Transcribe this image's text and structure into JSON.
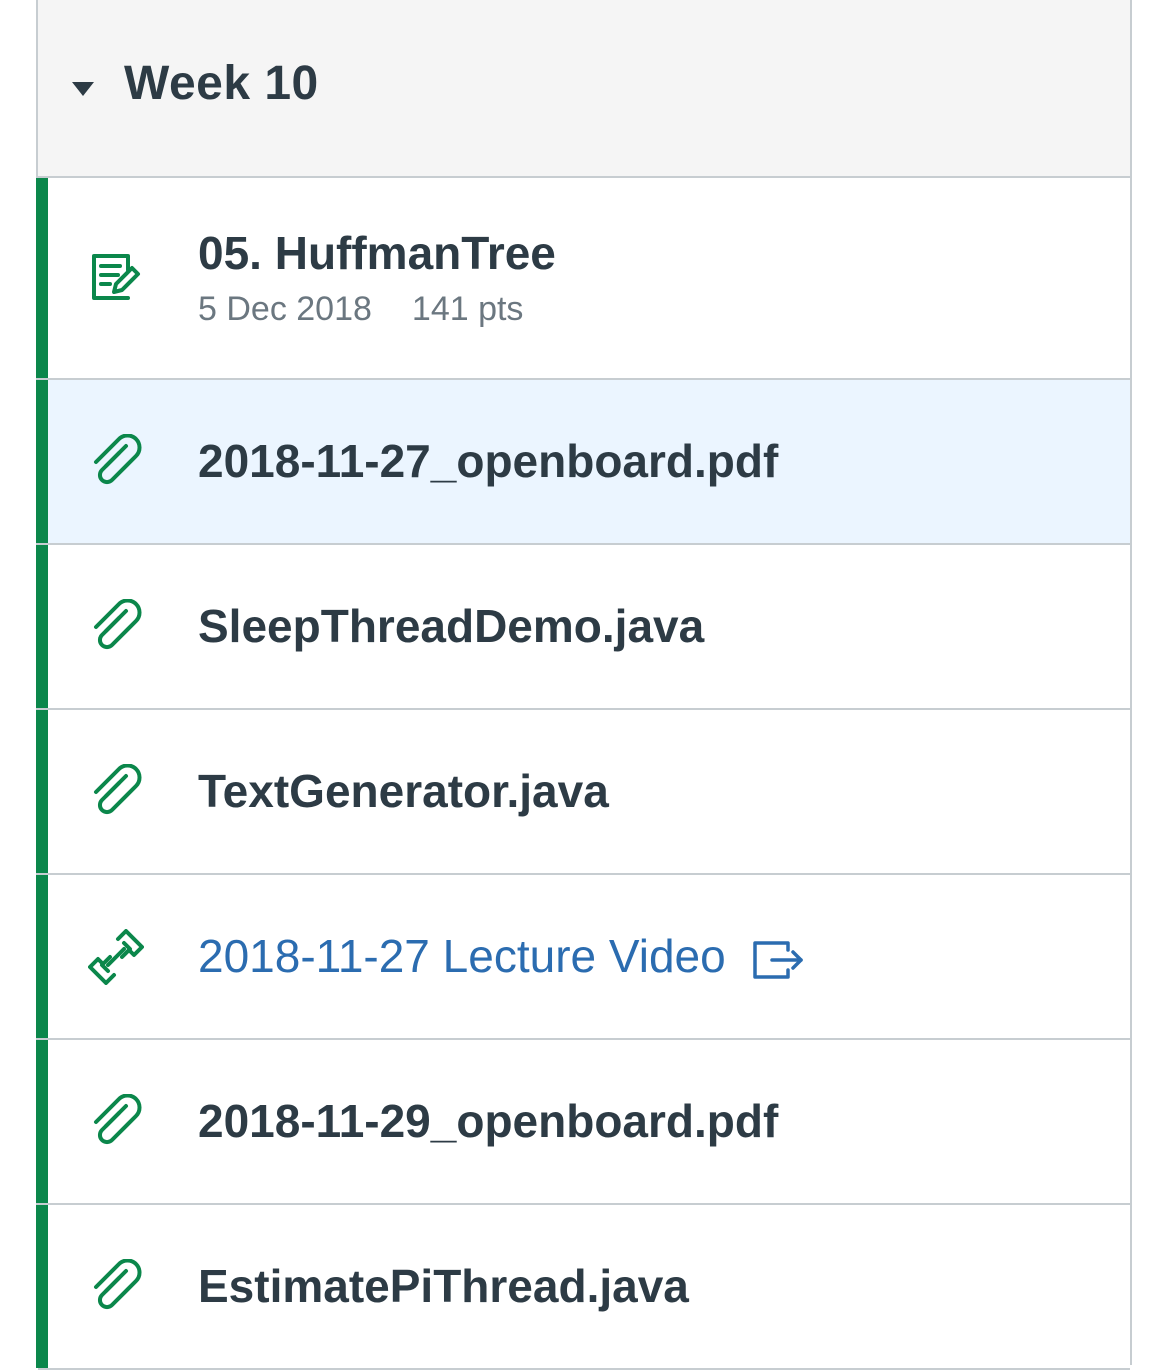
{
  "module": {
    "title": "Week 10",
    "toggle_icon": "caret-down-icon"
  },
  "colors": {
    "accent_green": "#0b874b",
    "text_dark": "#2d3b45",
    "link_blue": "#2b6cb0",
    "highlight_bg": "#ebf5ff",
    "header_bg": "#f5f5f5"
  },
  "items": [
    {
      "icon": "assignment-icon",
      "title": "05. HuffmanTree",
      "date": "5 Dec 2018",
      "points": "141 pts"
    },
    {
      "icon": "paperclip-icon",
      "title": "2018-11-27_openboard.pdf"
    },
    {
      "icon": "paperclip-icon",
      "title": "SleepThreadDemo.java"
    },
    {
      "icon": "paperclip-icon",
      "title": "TextGenerator.java"
    },
    {
      "icon": "link-icon",
      "title": "2018-11-27 Lecture Video",
      "trailing_icon": "external-link-icon"
    },
    {
      "icon": "paperclip-icon",
      "title": "2018-11-29_openboard.pdf"
    },
    {
      "icon": "paperclip-icon",
      "title": "EstimatePiThread.java"
    }
  ]
}
